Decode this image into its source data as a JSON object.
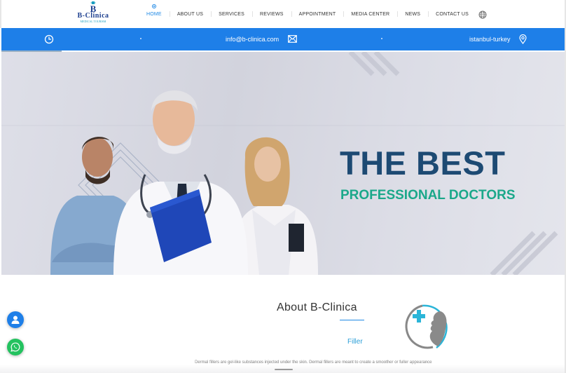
{
  "brand": {
    "name": "B-Clinica",
    "tagline": "MEDICAL TOURISM",
    "logo_letter": "B",
    "colors": {
      "primary_blue": "#1e7fe8",
      "dark_blue": "#1d4a73",
      "teal": "#1ba88a"
    }
  },
  "nav": {
    "items": [
      {
        "label": "HOME",
        "active": true
      },
      {
        "label": "ABOUT US"
      },
      {
        "label": "SERVICES"
      },
      {
        "label": "REVIEWS"
      },
      {
        "label": "APPOINTMENT"
      },
      {
        "label": "MEDIA CENTER"
      },
      {
        "label": "NEWS"
      },
      {
        "label": "CONTACT US"
      }
    ],
    "language_icon": "globe-icon"
  },
  "infobar": {
    "email": "info@b-clinica.com",
    "location": "istanbul-turkey",
    "icons": [
      "clock-icon",
      "mail-icon",
      "location-pin-icon"
    ]
  },
  "hero": {
    "title": "THE BEST",
    "subtitle": "PROFESSIONAL DOCTORS"
  },
  "about": {
    "title": "About B-Clinica",
    "service_label": "Filler",
    "text": "Dermal fillers are gel-like substances injected under the skin. Dermal fillers are meant to create a smoother or fuller appearance"
  },
  "floating": {
    "contact_icon": "user-icon",
    "whatsapp_icon": "whatsapp-icon"
  }
}
